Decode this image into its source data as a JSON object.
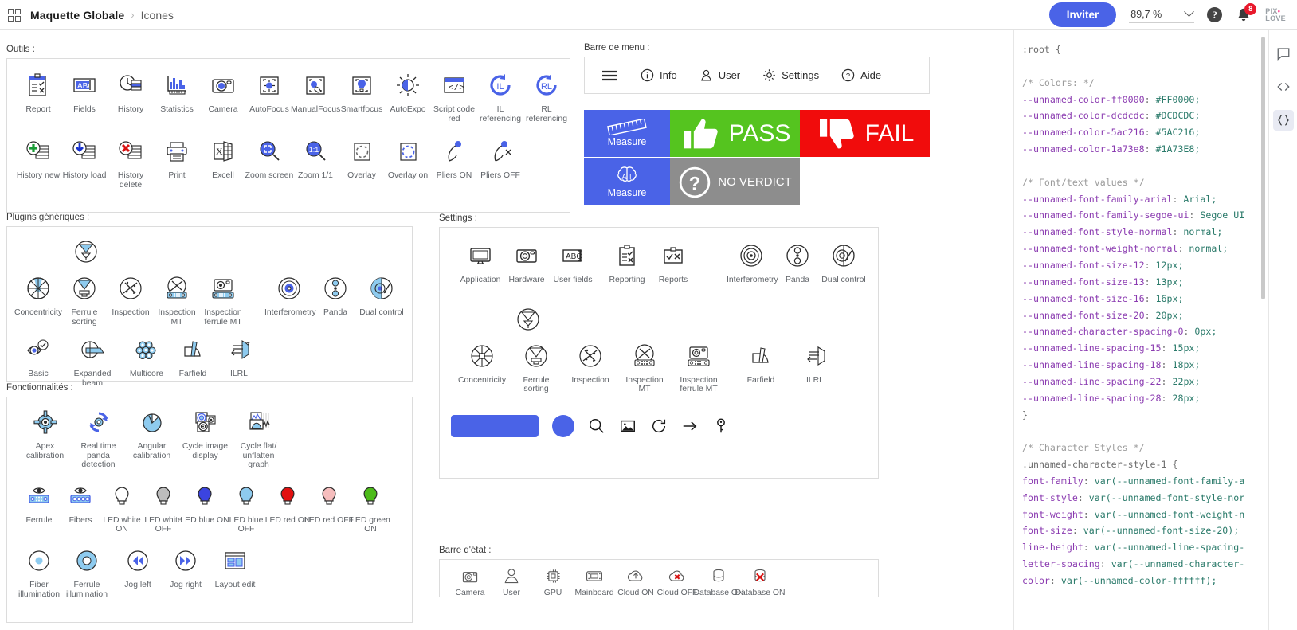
{
  "topbar": {
    "app_icon": "grid-icon",
    "breadcrumb_root": "Maquette Globale",
    "breadcrumb_sep": "›",
    "breadcrumb_leaf": "Icones",
    "invite_label": "Inviter",
    "zoom_value": "89,7 %",
    "help_glyph": "?",
    "notification_count": "8",
    "logo_line1": "PIX",
    "logo_line2": "LOVE"
  },
  "rail": {
    "items": [
      "comment-icon",
      "code-icon",
      "braces-icon"
    ]
  },
  "sections": {
    "outils": "Outils :",
    "plugins": "Plugins génériques :",
    "fonctionnalites": "Fonctionnalités :",
    "barre_de_menu": "Barre de menu :",
    "settings": "Settings :",
    "barre_etat": "Barre d'état :"
  },
  "outils": {
    "row1": [
      {
        "label": "Report",
        "icon": "report-icon"
      },
      {
        "label": "Fields",
        "icon": "fields-abc-icon"
      },
      {
        "label": "History",
        "icon": "history-clock-icon"
      },
      {
        "label": "Statistics",
        "icon": "statistics-bars-icon"
      },
      {
        "label": "Camera",
        "icon": "camera-icon"
      },
      {
        "label": "AutoFocus",
        "icon": "autofocus-icon"
      },
      {
        "label": "ManualFocus",
        "icon": "manualfocus-icon"
      },
      {
        "label": "Smartfocus",
        "icon": "smartfocus-bulb-icon"
      },
      {
        "label": "AutoExpo",
        "icon": "autoexpo-sun-icon"
      },
      {
        "label": "Script code red",
        "icon": "script-code-icon"
      },
      {
        "label": "IL referencing",
        "icon": "il-referencing-icon"
      },
      {
        "label": "RL referencing",
        "icon": "rl-referencing-icon"
      }
    ],
    "row2": [
      {
        "label": "History new",
        "icon": "history-new-icon"
      },
      {
        "label": "History load",
        "icon": "history-load-icon"
      },
      {
        "label": "History delete",
        "icon": "history-delete-icon"
      },
      {
        "label": "Print",
        "icon": "print-icon"
      },
      {
        "label": "Excell",
        "icon": "excel-icon"
      },
      {
        "label": "Zoom screen",
        "icon": "zoom-screen-icon"
      },
      {
        "label": "Zoom 1/1",
        "icon": "zoom-one-to-one-icon"
      },
      {
        "label": "Overlay",
        "icon": "overlay-off-icon"
      },
      {
        "label": "Overlay on",
        "icon": "overlay-on-icon"
      },
      {
        "label": "Pliers ON",
        "icon": "pliers-on-icon"
      },
      {
        "label": "Pliers OFF",
        "icon": "pliers-off-icon"
      }
    ]
  },
  "plugins": {
    "row0": [
      {
        "label": "",
        "icon": "ferrule-sorting-top-icon"
      }
    ],
    "row1": [
      {
        "label": "Concentricity",
        "icon": "concentricity-icon"
      },
      {
        "label": "Ferrule sorting",
        "icon": "ferrule-sorting-icon"
      },
      {
        "label": "Inspection",
        "icon": "inspection-icon"
      },
      {
        "label": "Inspection MT",
        "icon": "inspection-mt-icon"
      },
      {
        "label": "Inspection ferrule MT",
        "icon": "inspection-ferrule-mt-icon"
      },
      {
        "label": "Interferometry",
        "icon": "interferometry-icon"
      },
      {
        "label": "Panda",
        "icon": "panda-icon"
      },
      {
        "label": "Dual control",
        "icon": "dual-control-icon"
      }
    ],
    "row2": [
      {
        "label": "Basic",
        "icon": "basic-eye-icon"
      },
      {
        "label": "Expanded beam",
        "icon": "expanded-beam-icon"
      },
      {
        "label": "Multicore",
        "icon": "multicore-icon"
      },
      {
        "label": "Farfield",
        "icon": "farfield-icon"
      },
      {
        "label": "ILRL",
        "icon": "ilrl-icon"
      }
    ]
  },
  "fonctionnalites": {
    "row1": [
      {
        "label": "Apex calibration",
        "icon": "apex-calibration-icon"
      },
      {
        "label": "Real time panda detection",
        "icon": "realtime-panda-detection-icon"
      },
      {
        "label": "Angular calibration",
        "icon": "angular-calibration-icon"
      },
      {
        "label": "Cycle image display",
        "icon": "cycle-image-display-icon"
      },
      {
        "label": "Cycle flat/ unflatten graph",
        "icon": "cycle-flat-unflatten-graph-icon"
      }
    ],
    "row2": [
      {
        "label": "Ferrule",
        "icon": "ferrule-eye-icon"
      },
      {
        "label": "Fibers",
        "icon": "fibers-eye-icon"
      },
      {
        "label": "LED white ON",
        "icon": "led-white-on-icon"
      },
      {
        "label": "LED white OFF",
        "icon": "led-white-off-icon"
      },
      {
        "label": "LED blue ON",
        "icon": "led-blue-on-icon"
      },
      {
        "label": "LED blue OFF",
        "icon": "led-blue-off-icon"
      },
      {
        "label": "LED red ON",
        "icon": "led-red-on-icon"
      },
      {
        "label": "LED red OFF",
        "icon": "led-red-off-icon"
      },
      {
        "label": "LED green ON",
        "icon": "led-green-on-icon"
      }
    ],
    "row3": [
      {
        "label": "Fiber illumination",
        "icon": "fiber-illumination-icon"
      },
      {
        "label": "Ferrule illumination",
        "icon": "ferrule-illumination-icon"
      },
      {
        "label": "Jog left",
        "icon": "jog-left-icon"
      },
      {
        "label": "Jog right",
        "icon": "jog-right-icon"
      },
      {
        "label": "Layout edit",
        "icon": "layout-edit-icon"
      }
    ]
  },
  "menubar": [
    {
      "label": "",
      "icon": "hamburger-icon"
    },
    {
      "label": "Info",
      "icon": "info-icon"
    },
    {
      "label": "User",
      "icon": "user-icon"
    },
    {
      "label": "Settings",
      "icon": "gear-icon"
    },
    {
      "label": "Aide",
      "icon": "question-icon"
    }
  ],
  "verdicts": [
    {
      "label": "Measure",
      "icon": "ruler-icon",
      "color": "#4A63E7"
    },
    {
      "label": "PASS",
      "icon": "thumbs-up-icon",
      "color": "#55C41F"
    },
    {
      "label": "FAIL",
      "icon": "thumbs-down-icon",
      "color": "#F10C0C"
    },
    {
      "label": "Measure",
      "icon": "ai-brain-icon",
      "color": "#4A63E7"
    },
    {
      "label": "NO VERDICT",
      "icon": "question-circle-icon",
      "color": "#8D8D8D"
    }
  ],
  "settings": {
    "row1": [
      {
        "label": "Application",
        "icon": "monitor-icon"
      },
      {
        "label": "Hardware",
        "icon": "camera-outline-icon"
      },
      {
        "label": "User fields",
        "icon": "abc-field-icon"
      },
      {
        "label": "Reporting",
        "icon": "reporting-clipboard-icon"
      },
      {
        "label": "Reports",
        "icon": "reports-icon"
      },
      {
        "label": "Interferometry",
        "icon": "interferometry-outline-icon"
      },
      {
        "label": "Panda",
        "icon": "panda-outline-icon"
      },
      {
        "label": "Dual control",
        "icon": "dual-control-outline-icon"
      }
    ],
    "row0": [
      {
        "label": "",
        "icon": "ferrule-sorting-top-outline-icon"
      }
    ],
    "row2": [
      {
        "label": "Concentricity",
        "icon": "concentricity-outline-icon"
      },
      {
        "label": "Ferrule sorting",
        "icon": "ferrule-sorting-outline-icon"
      },
      {
        "label": "Inspection",
        "icon": "inspection-outline-icon"
      },
      {
        "label": "Inspection MT",
        "icon": "inspection-mt-outline-icon"
      },
      {
        "label": "Inspection ferrule MT",
        "icon": "inspection-ferrule-mt-outline-icon"
      },
      {
        "label": "Farfield",
        "icon": "farfield-outline-icon"
      },
      {
        "label": "ILRL",
        "icon": "ilrl-outline-icon"
      }
    ],
    "swatches": [
      {
        "name": "accent-rectangle",
        "color": "#4A63E7"
      },
      {
        "name": "accent-circle",
        "color": "#4A63E7"
      },
      {
        "name": "search-icon",
        "color": "#1A1A1A"
      },
      {
        "name": "image-icon",
        "color": "#1A1A1A"
      },
      {
        "name": "refresh-icon",
        "color": "#1A1A1A"
      },
      {
        "name": "arrow-right-icon",
        "color": "#1A1A1A"
      },
      {
        "name": "key-icon",
        "color": "#1A1A1A"
      }
    ]
  },
  "statusbar": [
    {
      "label": "Camera",
      "icon": "camera-status-icon"
    },
    {
      "label": "User",
      "icon": "user-status-icon"
    },
    {
      "label": "GPU",
      "icon": "gpu-chip-icon"
    },
    {
      "label": "Mainboard",
      "icon": "mainboard-icon"
    },
    {
      "label": "Cloud ON",
      "icon": "cloud-on-icon"
    },
    {
      "label": "Cloud OFF",
      "icon": "cloud-off-icon"
    },
    {
      "label": "Database ON",
      "icon": "database-on-icon"
    },
    {
      "label": "Database ON",
      "icon": "database-off-icon"
    }
  ],
  "code": {
    "text": ":root {\n\n/* Colors: */\n--unnamed-color-ff0000: #FF0000;\n--unnamed-color-dcdcdc: #DCDCDC;\n--unnamed-color-5ac216: #5AC216;\n--unnamed-color-1a73e8: #1A73E8;\n\n/* Font/text values */\n--unnamed-font-family-arial: Arial;\n--unnamed-font-family-segoe-ui: Segoe UI\n--unnamed-font-style-normal: normal;\n--unnamed-font-weight-normal: normal;\n--unnamed-font-size-12: 12px;\n--unnamed-font-size-13: 13px;\n--unnamed-font-size-16: 16px;\n--unnamed-font-size-20: 20px;\n--unnamed-character-spacing-0: 0px;\n--unnamed-line-spacing-15: 15px;\n--unnamed-line-spacing-18: 18px;\n--unnamed-line-spacing-22: 22px;\n--unnamed-line-spacing-28: 28px;\n}\n\n/* Character Styles */\n.unnamed-character-style-1 {\nfont-family: var(--unnamed-font-family-a\nfont-style: var(--unnamed-font-style-nor\nfont-weight: var(--unnamed-font-weight-n\nfont-size: var(--unnamed-font-size-20);\nline-height: var(--unnamed-line-spacing-\nletter-spacing: var(--unnamed-character-\ncolor: var(--unnamed-color-ffffff);"
  }
}
